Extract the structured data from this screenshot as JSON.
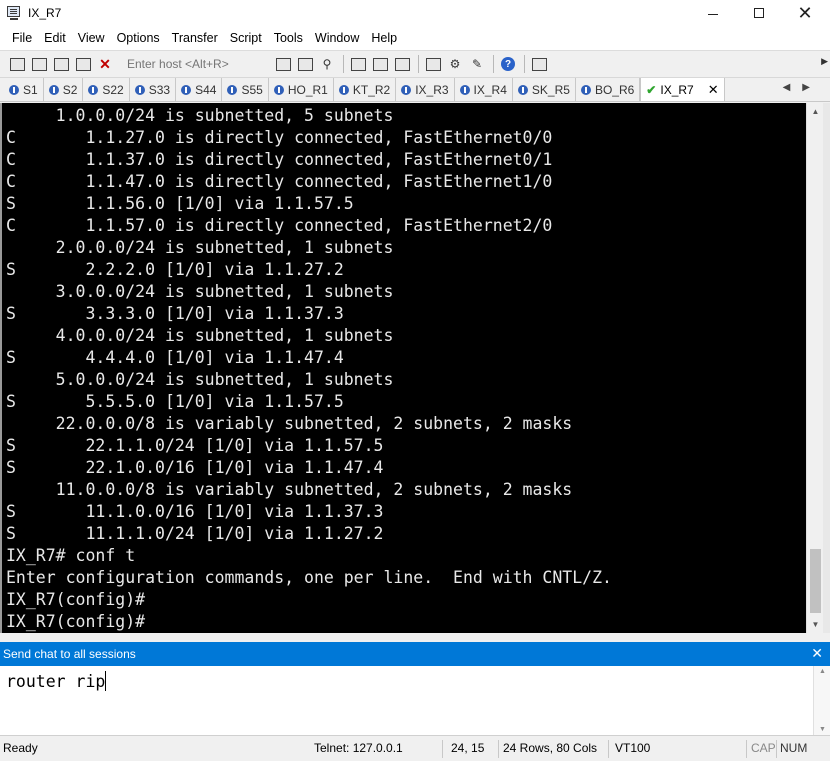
{
  "window": {
    "title": "IX_R7"
  },
  "menu": [
    "File",
    "Edit",
    "View",
    "Options",
    "Transfer",
    "Script",
    "Tools",
    "Window",
    "Help"
  ],
  "toolbar": {
    "host_placeholder": "Enter host <Alt+R>",
    "icons": [
      "connect-icon",
      "quick-connect-icon",
      "connect-tab-icon",
      "disconnect-icon",
      "copy-icon",
      "paste-icon",
      "find-icon",
      "print-icon",
      "print-setup-icon",
      "session-options-icon",
      "global-options-icon",
      "keymap-icon",
      "help-icon",
      "script-icon"
    ]
  },
  "tabs": [
    {
      "label": "S1"
    },
    {
      "label": "S2"
    },
    {
      "label": "S22"
    },
    {
      "label": "S33"
    },
    {
      "label": "S44"
    },
    {
      "label": "S55"
    },
    {
      "label": "HO_R1"
    },
    {
      "label": "KT_R2"
    },
    {
      "label": "IX_R3"
    },
    {
      "label": "IX_R4"
    },
    {
      "label": "SK_R5"
    },
    {
      "label": "BO_R6"
    },
    {
      "label": "IX_R7",
      "active": true
    }
  ],
  "terminal": {
    "lines": [
      "     1.0.0.0/24 is subnetted, 5 subnets",
      "C       1.1.27.0 is directly connected, FastEthernet0/0",
      "C       1.1.37.0 is directly connected, FastEthernet0/1",
      "C       1.1.47.0 is directly connected, FastEthernet1/0",
      "S       1.1.56.0 [1/0] via 1.1.57.5",
      "C       1.1.57.0 is directly connected, FastEthernet2/0",
      "     2.0.0.0/24 is subnetted, 1 subnets",
      "S       2.2.2.0 [1/0] via 1.1.27.2",
      "     3.0.0.0/24 is subnetted, 1 subnets",
      "S       3.3.3.0 [1/0] via 1.1.37.3",
      "     4.0.0.0/24 is subnetted, 1 subnets",
      "S       4.4.4.0 [1/0] via 1.1.47.4",
      "     5.0.0.0/24 is subnetted, 1 subnets",
      "S       5.5.5.0 [1/0] via 1.1.57.5",
      "     22.0.0.0/8 is variably subnetted, 2 subnets, 2 masks",
      "S       22.1.1.0/24 [1/0] via 1.1.57.5",
      "S       22.1.0.0/16 [1/0] via 1.1.47.4",
      "     11.0.0.0/8 is variably subnetted, 2 subnets, 2 masks",
      "S       11.1.0.0/16 [1/0] via 1.1.37.3",
      "S       11.1.1.0/24 [1/0] via 1.1.27.2",
      "IX_R7# conf t",
      "Enter configuration commands, one per line.  End with CNTL/Z.",
      "IX_R7(config)#",
      "IX_R7(config)#"
    ]
  },
  "chat": {
    "header": "Send chat to all sessions",
    "input_value": "router rip"
  },
  "status": {
    "state": "Ready",
    "connection": "Telnet: 127.0.0.1",
    "cursor": "24,  15",
    "size": "24 Rows, 80 Cols",
    "emulation": "VT100",
    "caps": "CAP",
    "num": "NUM"
  }
}
